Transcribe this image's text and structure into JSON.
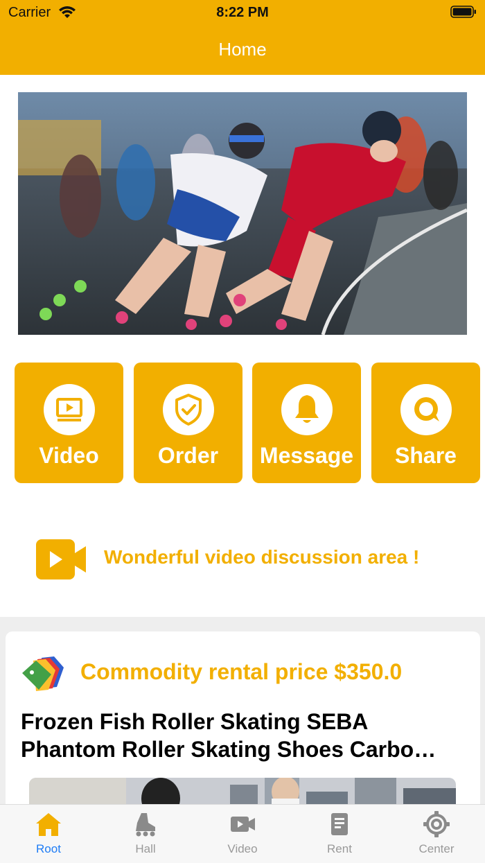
{
  "status": {
    "carrier": "Carrier",
    "time": "8:22 PM"
  },
  "nav": {
    "title": "Home"
  },
  "tiles": [
    {
      "label": "Video",
      "icon": "video-screen-icon"
    },
    {
      "label": "Order",
      "icon": "shield-check-icon"
    },
    {
      "label": "Message",
      "icon": "bell-icon"
    },
    {
      "label": "Share",
      "icon": "chat-bubble-icon"
    }
  ],
  "discussion": {
    "text": "Wonderful video discussion area !"
  },
  "product": {
    "price_text": "Commodity rental price $350.0",
    "title_line1": "Frozen Fish Roller Skating SEBA",
    "title_line2": "Phantom Roller Skating Shoes Carbo…"
  },
  "tabs": [
    {
      "label": "Root",
      "icon": "home-icon",
      "active": true
    },
    {
      "label": "Hall",
      "icon": "skate-icon",
      "active": false
    },
    {
      "label": "Video",
      "icon": "video-camera-icon",
      "active": false
    },
    {
      "label": "Rent",
      "icon": "document-icon",
      "active": false
    },
    {
      "label": "Center",
      "icon": "gear-icon",
      "active": false
    }
  ],
  "colors": {
    "accent": "#F2AF00",
    "tab_active": "#1E7CF5",
    "tab_inactive": "#999999",
    "background_gray": "#EEEEEE"
  }
}
